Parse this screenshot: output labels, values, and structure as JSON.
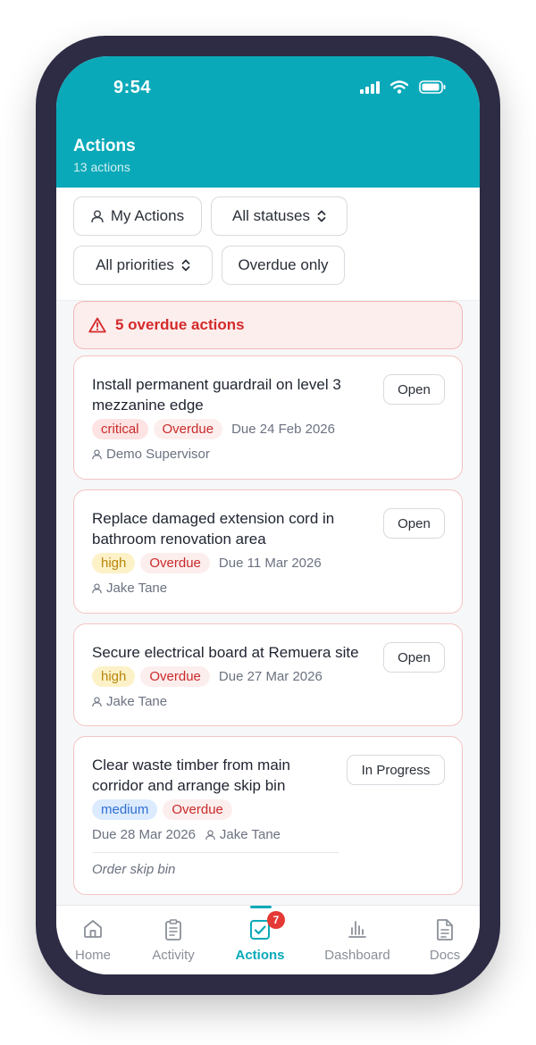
{
  "status_bar": {
    "time": "9:54"
  },
  "header": {
    "title": "Actions",
    "subtitle": "13 actions"
  },
  "filters": {
    "my_actions": "My Actions",
    "statuses": "All statuses",
    "priorities": "All priorities",
    "overdue_only": "Overdue only"
  },
  "banner": {
    "text": "5 overdue actions"
  },
  "actions": [
    {
      "title": "Install permanent guardrail on level 3 mezzanine edge",
      "status": "Open",
      "priority": "critical",
      "overdue": "Overdue",
      "due": "Due 24 Feb 2026",
      "assignee": "Demo Supervisor"
    },
    {
      "title": "Replace damaged extension cord in bathroom renovation area",
      "status": "Open",
      "priority": "high",
      "overdue": "Overdue",
      "due": "Due 11 Mar 2026",
      "assignee": "Jake Tane"
    },
    {
      "title": "Secure electrical board at Remuera site",
      "status": "Open",
      "priority": "high",
      "overdue": "Overdue",
      "due": "Due 27 Mar 2026",
      "assignee": "Jake Tane"
    },
    {
      "title": "Clear waste timber from main corridor and arrange skip bin",
      "status": "In Progress",
      "priority": "medium",
      "overdue": "Overdue",
      "due": "Due 28 Mar 2026",
      "assignee": "Jake Tane",
      "note": "Order skip bin"
    }
  ],
  "tabs": [
    {
      "label": "Home",
      "icon": "home-icon"
    },
    {
      "label": "Activity",
      "icon": "clipboard-icon"
    },
    {
      "label": "Actions",
      "icon": "checkbox-icon",
      "badge": "7"
    },
    {
      "label": "Dashboard",
      "icon": "bar-chart-icon"
    },
    {
      "label": "Docs",
      "icon": "document-icon"
    }
  ],
  "colors": {
    "accent": "#0aa9b9",
    "danger": "#d42a2a",
    "badge": "#e53935"
  }
}
